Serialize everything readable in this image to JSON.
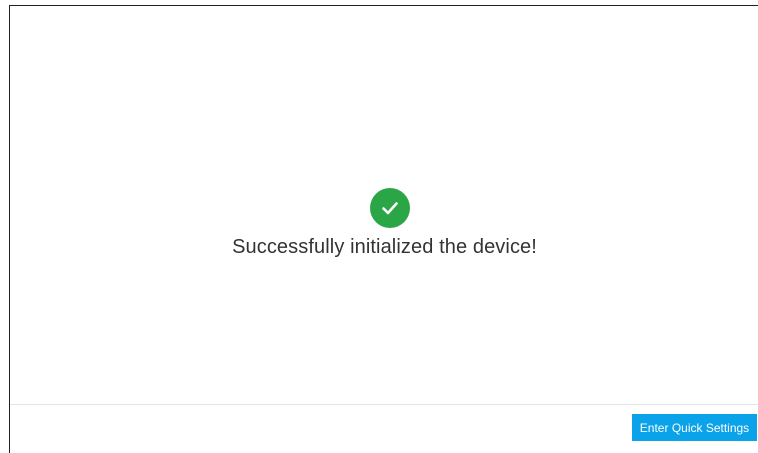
{
  "status": {
    "icon": "check-circle-icon",
    "icon_color": "#2aa646",
    "message": "Successfully initialized the device!"
  },
  "footer": {
    "quick_settings_label": "Enter Quick Settings",
    "button_color": "#0aa2e8"
  }
}
